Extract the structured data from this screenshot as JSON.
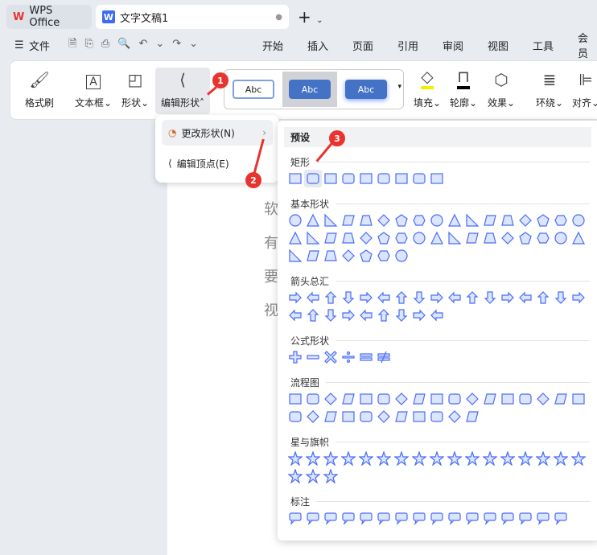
{
  "tabs": {
    "wps": "WPS Office",
    "doc": "文字文稿1"
  },
  "menu": {
    "file": "文件",
    "items": [
      "开始",
      "插入",
      "页面",
      "引用",
      "审阅",
      "视图",
      "工具",
      "会员"
    ]
  },
  "ribbon": {
    "format_painter": "格式刷",
    "textbox": "文本框",
    "shape": "形状",
    "edit_shape": "编辑形状",
    "style_abc": "Abc",
    "fill": "填充",
    "outline": "轮廓",
    "effect": "效果",
    "wrap": "环绕",
    "align": "对齐"
  },
  "context_menu": {
    "change_shape": "更改形状(N)",
    "edit_points": "编辑顶点(E)"
  },
  "document": {
    "lines": [
      "软",
      "有",
      "要",
      "视"
    ]
  },
  "panel": {
    "header": "预设",
    "sections": [
      {
        "label": "矩形",
        "rows": [
          9
        ],
        "kinds": [
          "rect",
          "roundrect"
        ]
      },
      {
        "label": "基本形状",
        "rows": [
          17,
          17,
          7
        ],
        "kinds": [
          "circle",
          "triangle",
          "rtriangle",
          "parallelogram",
          "trapezoid",
          "diamond",
          "pentagon",
          "hexagon"
        ]
      },
      {
        "label": "箭头总汇",
        "rows": [
          17,
          9
        ],
        "kinds": [
          "arrow-right",
          "arrow-left",
          "arrow-up",
          "arrow-down"
        ]
      },
      {
        "label": "公式形状",
        "rows": [
          6
        ],
        "kinds": [
          "plus",
          "minus",
          "multiply",
          "divide",
          "equal",
          "notequal"
        ]
      },
      {
        "label": "流程图",
        "rows": [
          17,
          11
        ],
        "kinds": [
          "rect",
          "roundrect",
          "diamond",
          "parallelogram"
        ]
      },
      {
        "label": "星与旗帜",
        "rows": [
          17,
          3
        ],
        "kinds": [
          "star"
        ]
      },
      {
        "label": "标注",
        "rows": [
          16
        ],
        "kinds": [
          "callout"
        ]
      }
    ]
  },
  "badges": [
    "1",
    "2",
    "3"
  ],
  "colors": {
    "accent": "#4472c4",
    "shape_fill": "#dbe5fd",
    "shape_stroke": "#4a6cf7",
    "badge": "#e8332f"
  }
}
